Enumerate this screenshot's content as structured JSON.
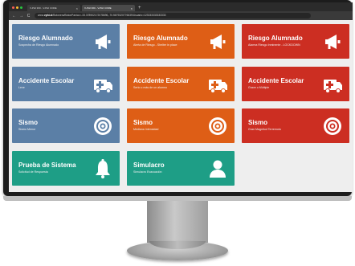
{
  "browser": {
    "tabs": [
      {
        "label": "V-PHI 360 - V-PHI CORE"
      },
      {
        "label": "V-PHI 360 - V-PHI CORE"
      }
    ],
    "url_prefix": "www.",
    "url_domain": "vphi.cl",
    "url_rest": "/Botonera/BotonPanico=-33.378902172078696,-70.5679320776639/Usuario=123333333333333"
  },
  "colors": {
    "blue": "#5b7fa6",
    "orange": "#de5e16",
    "red": "#cc2e22",
    "green": "#1e9e86"
  },
  "tiles": [
    {
      "title": "Riesgo Alumnado",
      "subtitle": "Sospecha de Riesgo Alumnado",
      "color": "blue",
      "icon": "megaphone-icon"
    },
    {
      "title": "Riesgo Alumnado",
      "subtitle": "Alerta de Riesgo - Shelter in place",
      "color": "orange",
      "icon": "megaphone-icon"
    },
    {
      "title": "Riesgo Alumnado",
      "subtitle": "Alarma Riesgo Inminente - LOCKDOWN",
      "color": "red",
      "icon": "megaphone-icon"
    },
    {
      "title": "Accidente Escolar",
      "subtitle": "Leve",
      "color": "blue",
      "icon": "ambulance-icon"
    },
    {
      "title": "Accidente Escolar",
      "subtitle": "Serio o más de un alumno",
      "color": "orange",
      "icon": "ambulance-icon"
    },
    {
      "title": "Accidente Escolar",
      "subtitle": "Grave o Múltiple",
      "color": "red",
      "icon": "ambulance-icon"
    },
    {
      "title": "Sismo",
      "subtitle": "Sismo Menor",
      "color": "blue",
      "icon": "target-icon"
    },
    {
      "title": "Sismo",
      "subtitle": "Mediana Intensidad",
      "color": "orange",
      "icon": "target-icon"
    },
    {
      "title": "Sismo",
      "subtitle": "Gran Magnitud Terremoto",
      "color": "red",
      "icon": "target-icon"
    },
    {
      "title": "Prueba de Sistema",
      "subtitle": "Solicitud de Respuesta",
      "color": "green",
      "icon": "bell-icon"
    },
    {
      "title": "Simulacro",
      "subtitle": "Simulacro Evacuación",
      "color": "green",
      "icon": "user-icon"
    }
  ]
}
